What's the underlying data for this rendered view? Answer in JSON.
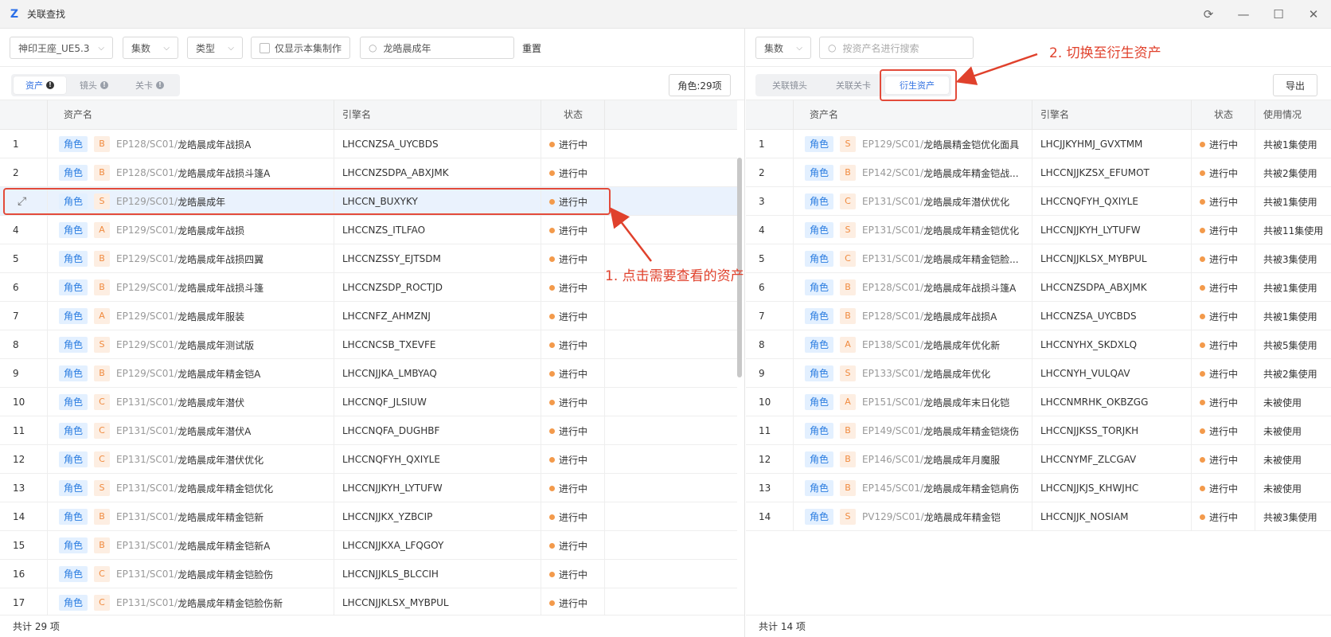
{
  "window": {
    "title": "关联查找",
    "controls": [
      "refresh-icon",
      "minimize-icon",
      "maximize-icon",
      "close-icon"
    ]
  },
  "left": {
    "toolbar": {
      "project_select": "神印王座_UE5.3",
      "episode_select": "集数",
      "type_select": "类型",
      "only_this_episode": "仅显示本集制作",
      "search_value": "龙皓晨成年",
      "reset": "重置"
    },
    "tabs": [
      {
        "label": "资产",
        "active": true
      },
      {
        "label": "镜头",
        "active": false
      },
      {
        "label": "关卡",
        "active": false
      }
    ],
    "count_badge": "角色:29项",
    "columns": [
      "资产名",
      "引擎名",
      "状态"
    ],
    "rows": [
      {
        "idx": "1",
        "tag": "角色",
        "level": "B",
        "path": "EP128/SC01/",
        "name": "龙皓晨成年战损A",
        "engine": "LHCCNZSA_UYCBDS",
        "status": "进行中"
      },
      {
        "idx": "2",
        "tag": "角色",
        "level": "B",
        "path": "EP128/SC01/",
        "name": "龙皓晨成年战损斗篷A",
        "engine": "LHCCNZSDPA_ABXJMK",
        "status": "进行中"
      },
      {
        "idx": "",
        "tag": "角色",
        "level": "S",
        "path": "EP129/SC01/",
        "name": "龙皓晨成年",
        "engine": "LHCCN_BUXYKY",
        "status": "进行中",
        "selected": true
      },
      {
        "idx": "4",
        "tag": "角色",
        "level": "A",
        "path": "EP129/SC01/",
        "name": "龙皓晨成年战损",
        "engine": "LHCCNZS_ITLFAO",
        "status": "进行中"
      },
      {
        "idx": "5",
        "tag": "角色",
        "level": "B",
        "path": "EP129/SC01/",
        "name": "龙皓晨成年战损四翼",
        "engine": "LHCCNZSSY_EJTSDM",
        "status": "进行中"
      },
      {
        "idx": "6",
        "tag": "角色",
        "level": "B",
        "path": "EP129/SC01/",
        "name": "龙皓晨成年战损斗篷",
        "engine": "LHCCNZSDP_ROCTJD",
        "status": "进行中"
      },
      {
        "idx": "7",
        "tag": "角色",
        "level": "A",
        "path": "EP129/SC01/",
        "name": "龙皓晨成年服装",
        "engine": "LHCCNFZ_AHMZNJ",
        "status": "进行中"
      },
      {
        "idx": "8",
        "tag": "角色",
        "level": "S",
        "path": "EP129/SC01/",
        "name": "龙皓晨成年测试版",
        "engine": "LHCCNCSB_TXEVFE",
        "status": "进行中"
      },
      {
        "idx": "9",
        "tag": "角色",
        "level": "B",
        "path": "EP129/SC01/",
        "name": "龙皓晨成年精金铠A",
        "engine": "LHCCNJJKA_LMBYAQ",
        "status": "进行中"
      },
      {
        "idx": "10",
        "tag": "角色",
        "level": "C",
        "path": "EP131/SC01/",
        "name": "龙皓晨成年潜伏",
        "engine": "LHCCNQF_JLSIUW",
        "status": "进行中"
      },
      {
        "idx": "11",
        "tag": "角色",
        "level": "C",
        "path": "EP131/SC01/",
        "name": "龙皓晨成年潜伏A",
        "engine": "LHCCNQFA_DUGHBF",
        "status": "进行中"
      },
      {
        "idx": "12",
        "tag": "角色",
        "level": "C",
        "path": "EP131/SC01/",
        "name": "龙皓晨成年潜伏优化",
        "engine": "LHCCNQFYH_QXIYLE",
        "status": "进行中"
      },
      {
        "idx": "13",
        "tag": "角色",
        "level": "S",
        "path": "EP131/SC01/",
        "name": "龙皓晨成年精金铠优化",
        "engine": "LHCCNJJKYH_LYTUFW",
        "status": "进行中"
      },
      {
        "idx": "14",
        "tag": "角色",
        "level": "B",
        "path": "EP131/SC01/",
        "name": "龙皓晨成年精金铠新",
        "engine": "LHCCNJJKX_YZBCIP",
        "status": "进行中"
      },
      {
        "idx": "15",
        "tag": "角色",
        "level": "B",
        "path": "EP131/SC01/",
        "name": "龙皓晨成年精金铠新A",
        "engine": "LHCCNJJKXA_LFQGOY",
        "status": "进行中"
      },
      {
        "idx": "16",
        "tag": "角色",
        "level": "C",
        "path": "EP131/SC01/",
        "name": "龙皓晨成年精金铠脸伤",
        "engine": "LHCCNJJKLS_BLCCIH",
        "status": "进行中"
      },
      {
        "idx": "17",
        "tag": "角色",
        "level": "C",
        "path": "EP131/SC01/",
        "name": "龙皓晨成年精金铠脸伤新",
        "engine": "LHCCNJJKLSX_MYBPUL",
        "status": "进行中"
      }
    ],
    "footer": "共计 29 项"
  },
  "right": {
    "toolbar": {
      "episode_select": "集数",
      "search_placeholder": "按资产名进行搜索"
    },
    "tabs": [
      {
        "label": "关联镜头",
        "active": false
      },
      {
        "label": "关联关卡",
        "active": false
      },
      {
        "label": "衍生资产",
        "active": true
      }
    ],
    "export": "导出",
    "columns": [
      "资产名",
      "引擎名",
      "状态",
      "使用情况"
    ],
    "rows": [
      {
        "idx": "1",
        "tag": "角色",
        "level": "S",
        "path": "EP129/SC01/",
        "name": "龙皓晨精金铠优化面具",
        "engine": "LHCJJKYHMJ_GVXTMM",
        "status": "进行中",
        "usage": "共被1集使用"
      },
      {
        "idx": "2",
        "tag": "角色",
        "level": "B",
        "path": "EP142/SC01/",
        "name": "龙皓晨成年精金铠战...",
        "engine": "LHCCNJJKZSX_EFUMOT",
        "status": "进行中",
        "usage": "共被2集使用"
      },
      {
        "idx": "3",
        "tag": "角色",
        "level": "C",
        "path": "EP131/SC01/",
        "name": "龙皓晨成年潜伏优化",
        "engine": "LHCCNQFYH_QXIYLE",
        "status": "进行中",
        "usage": "共被1集使用"
      },
      {
        "idx": "4",
        "tag": "角色",
        "level": "S",
        "path": "EP131/SC01/",
        "name": "龙皓晨成年精金铠优化",
        "engine": "LHCCNJJKYH_LYTUFW",
        "status": "进行中",
        "usage": "共被11集使用"
      },
      {
        "idx": "5",
        "tag": "角色",
        "level": "C",
        "path": "EP131/SC01/",
        "name": "龙皓晨成年精金铠脸...",
        "engine": "LHCCNJJKLSX_MYBPUL",
        "status": "进行中",
        "usage": "共被3集使用"
      },
      {
        "idx": "6",
        "tag": "角色",
        "level": "B",
        "path": "EP128/SC01/",
        "name": "龙皓晨成年战损斗篷A",
        "engine": "LHCCNZSDPA_ABXJMK",
        "status": "进行中",
        "usage": "共被1集使用"
      },
      {
        "idx": "7",
        "tag": "角色",
        "level": "B",
        "path": "EP128/SC01/",
        "name": "龙皓晨成年战损A",
        "engine": "LHCCNZSA_UYCBDS",
        "status": "进行中",
        "usage": "共被1集使用"
      },
      {
        "idx": "8",
        "tag": "角色",
        "level": "A",
        "path": "EP138/SC01/",
        "name": "龙皓晨成年优化新",
        "engine": "LHCCNYHX_SKDXLQ",
        "status": "进行中",
        "usage": "共被5集使用"
      },
      {
        "idx": "9",
        "tag": "角色",
        "level": "S",
        "path": "EP133/SC01/",
        "name": "龙皓晨成年优化",
        "engine": "LHCCNYH_VULQAV",
        "status": "进行中",
        "usage": "共被2集使用"
      },
      {
        "idx": "10",
        "tag": "角色",
        "level": "A",
        "path": "EP151/SC01/",
        "name": "龙皓晨成年末日化铠",
        "engine": "LHCCNMRHK_OKBZGG",
        "status": "进行中",
        "usage": "未被使用"
      },
      {
        "idx": "11",
        "tag": "角色",
        "level": "B",
        "path": "EP149/SC01/",
        "name": "龙皓晨成年精金铠烧伤",
        "engine": "LHCCNJJKSS_TORJKH",
        "status": "进行中",
        "usage": "未被使用"
      },
      {
        "idx": "12",
        "tag": "角色",
        "level": "B",
        "path": "EP146/SC01/",
        "name": "龙皓晨成年月魔服",
        "engine": "LHCCNYMF_ZLCGAV",
        "status": "进行中",
        "usage": "未被使用"
      },
      {
        "idx": "13",
        "tag": "角色",
        "level": "B",
        "path": "EP145/SC01/",
        "name": "龙皓晨成年精金铠肩伤",
        "engine": "LHCCNJJKJS_KHWJHC",
        "status": "进行中",
        "usage": "未被使用"
      },
      {
        "idx": "14",
        "tag": "角色",
        "level": "S",
        "path": "PV129/SC01/",
        "name": "龙皓晨成年精金铠",
        "engine": "LHCCNJJK_NOSIAM",
        "status": "进行中",
        "usage": "共被3集使用"
      }
    ],
    "footer": "共计 14 项"
  },
  "annotations": {
    "step1": "1. 点击需要查看的资产",
    "step2": "2. 切换至衍生资产"
  },
  "colors": {
    "accent": "#2f6fe0",
    "tag_role_bg": "#e3f0ff",
    "tag_level_bg": "#fdeee2",
    "status_dot": "#f39a4b",
    "annotation": "#e0412c"
  }
}
